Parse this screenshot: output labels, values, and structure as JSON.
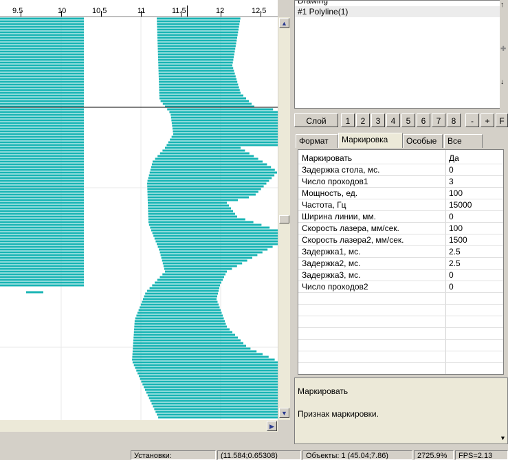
{
  "ruler": {
    "ticks": [
      "9.5",
      "10",
      "10.5",
      "11",
      "11.5",
      "12",
      "12.5"
    ]
  },
  "object_list": {
    "items": [
      {
        "label": "Drawing"
      },
      {
        "label": "#1 Polyline(1)"
      }
    ]
  },
  "layer_bar": {
    "layer_label": "Слой",
    "numbers": [
      "1",
      "2",
      "3",
      "4",
      "5",
      "6",
      "7",
      "8"
    ],
    "minus": "-",
    "plus": "+",
    "f": "F"
  },
  "tabs": [
    "Формат",
    "Маркировка",
    "Особые",
    "Все"
  ],
  "active_tab": "Маркировка",
  "properties": [
    {
      "name": "Маркировать",
      "value": "Да"
    },
    {
      "name": "Задержка стола, мс.",
      "value": "0"
    },
    {
      "name": "Число проходов1",
      "value": "3"
    },
    {
      "name": "Мощность, ед.",
      "value": "100"
    },
    {
      "name": "Частота, Гц",
      "value": "15000"
    },
    {
      "name": "Ширина линии, мм.",
      "value": "0"
    },
    {
      "name": "Скорость лазера, мм/сек.",
      "value": "100"
    },
    {
      "name": "Скорость лазера2, мм/сек.",
      "value": "1500"
    },
    {
      "name": "Задержка1, мс.",
      "value": "2.5"
    },
    {
      "name": "Задержка2, мс.",
      "value": "2.5"
    },
    {
      "name": "Задержка3, мс.",
      "value": "0"
    },
    {
      "name": "Число проходов2",
      "value": "0"
    }
  ],
  "description": {
    "title": "Маркировать",
    "text": "Признак маркировки."
  },
  "statusbar": {
    "settings": "Установки:",
    "coords": "(11.584;0.65308)",
    "objects": "Объекты: 1 (45.04;7.86)",
    "zoom": "2725.9%",
    "fps": "FPS=2.13"
  },
  "colors": {
    "hatch": "#18b4b4",
    "panel": "#d4d0c8"
  }
}
